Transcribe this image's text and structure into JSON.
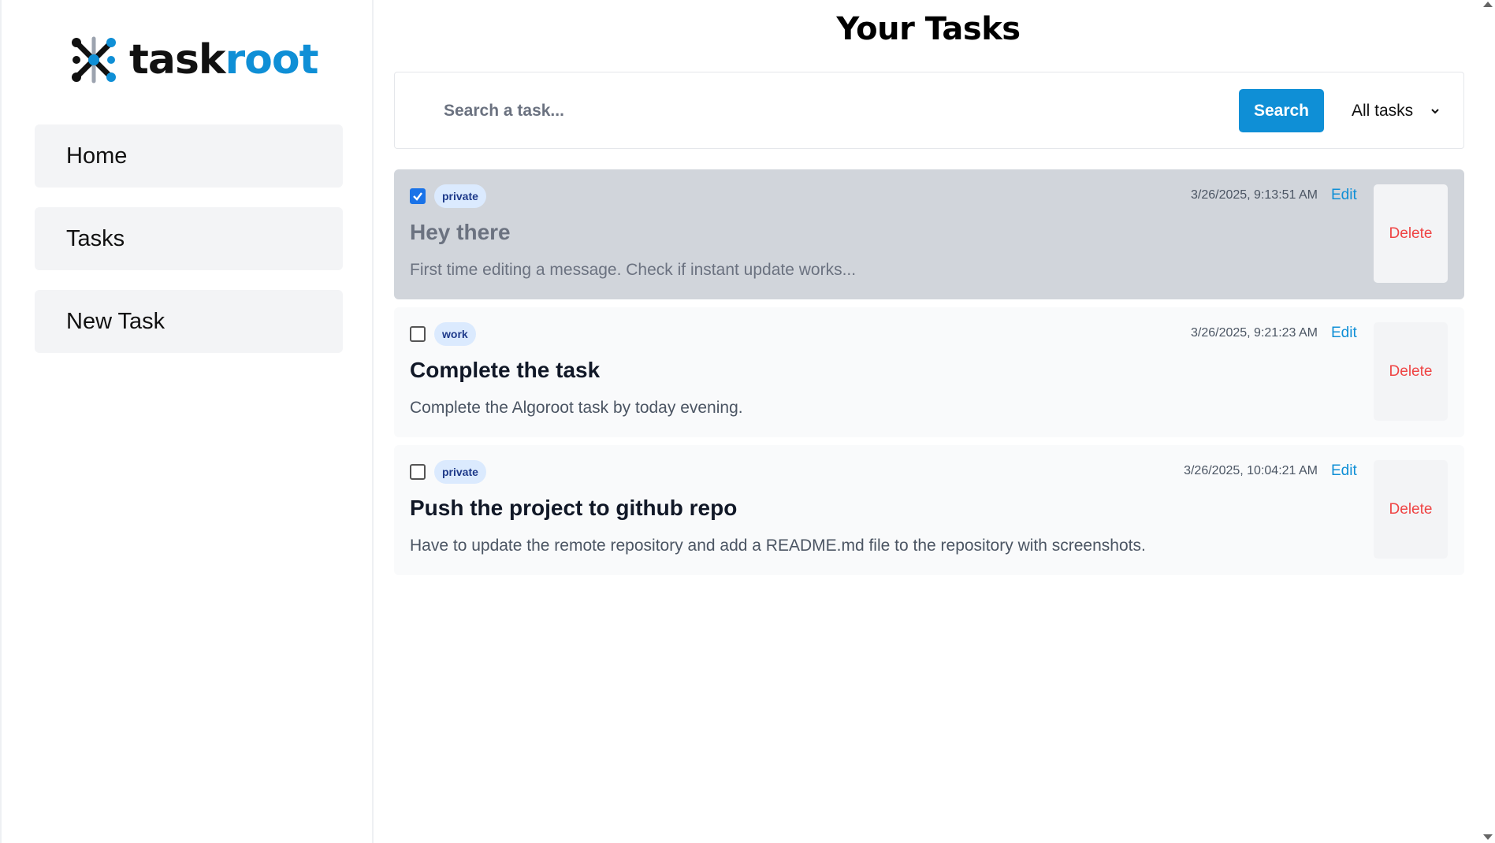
{
  "brand": {
    "name_part1": "task",
    "name_part2": "root"
  },
  "sidebar": {
    "items": [
      {
        "label": "Home"
      },
      {
        "label": "Tasks"
      },
      {
        "label": "New Task"
      }
    ]
  },
  "main": {
    "title": "Your Tasks",
    "search": {
      "placeholder": "Search a task...",
      "value": "",
      "button_label": "Search"
    },
    "filter": {
      "selected": "All tasks"
    },
    "tasks": [
      {
        "completed": true,
        "tag": "private",
        "timestamp": "3/26/2025, 9:13:51 AM",
        "title": "Hey there",
        "description": "First time editing a message. Check if instant update works...",
        "edit_label": "Edit",
        "delete_label": "Delete"
      },
      {
        "completed": false,
        "tag": "work",
        "timestamp": "3/26/2025, 9:21:23 AM",
        "title": "Complete the task",
        "description": "Complete the Algoroot task by today evening.",
        "edit_label": "Edit",
        "delete_label": "Delete"
      },
      {
        "completed": false,
        "tag": "private",
        "timestamp": "3/26/2025, 10:04:21 AM",
        "title": "Push the project to github repo",
        "description": "Have to update the remote repository and add a README.md file to the repository with screenshots.",
        "edit_label": "Edit",
        "delete_label": "Delete"
      }
    ]
  },
  "colors": {
    "accent": "#0f8fd6",
    "danger": "#ef4444",
    "tag_bg": "#dbeafe",
    "completed_card": "#d1d5db"
  }
}
